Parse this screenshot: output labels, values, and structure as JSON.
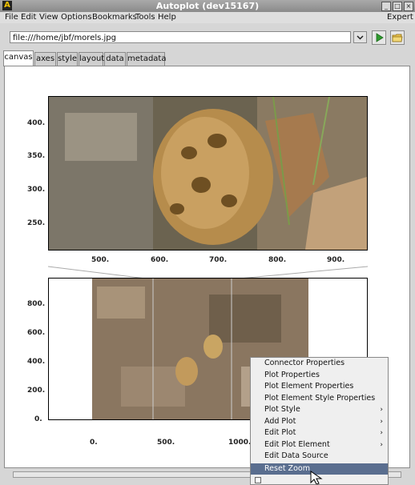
{
  "window": {
    "title": "Autoplot (dev15167)"
  },
  "menubar": {
    "items": [
      "File",
      "Edit",
      "View",
      "Options",
      "Bookmarks",
      "Tools",
      "Help"
    ],
    "right_label": "Expert"
  },
  "address": {
    "value": "file:///home/jbf/morels.jpg"
  },
  "tabs": [
    "canvas",
    "axes",
    "style",
    "layout",
    "data",
    "metadata"
  ],
  "plots": {
    "top": {
      "y_ticks": [
        "400.",
        "350.",
        "300.",
        "250."
      ],
      "x_ticks": [
        "500.",
        "600.",
        "700.",
        "800.",
        "900."
      ]
    },
    "bottom": {
      "y_ticks": [
        "800.",
        "600.",
        "400.",
        "200.",
        "0."
      ],
      "x_ticks": [
        "0.",
        "500.",
        "1000."
      ]
    }
  },
  "context_menu": {
    "items": [
      {
        "label": "Connector Properties",
        "submenu": false
      },
      {
        "label": "Plot Properties",
        "submenu": false
      },
      {
        "label": "Plot Element Properties",
        "submenu": false
      },
      {
        "label": "Plot Element Style Properties",
        "submenu": false
      },
      {
        "label": "Plot Style",
        "submenu": true
      },
      {
        "label": "Add Plot",
        "submenu": true
      },
      {
        "label": "Edit Plot",
        "submenu": true
      },
      {
        "label": "Edit Plot Element",
        "submenu": true
      },
      {
        "label": "Edit Data Source",
        "submenu": false
      },
      {
        "label": "Reset Zoom",
        "submenu": false,
        "highlighted": true
      }
    ]
  },
  "colors": {
    "menu_highlight": "#5a6e8f",
    "titlebar": "#9a9a9a"
  }
}
